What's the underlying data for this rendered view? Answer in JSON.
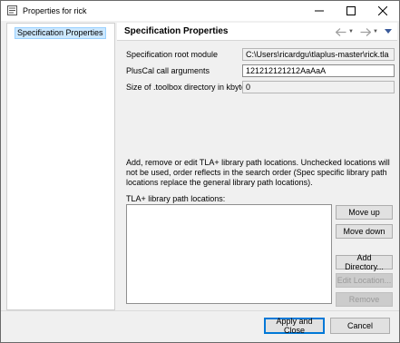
{
  "window": {
    "title": "Properties for rick",
    "controls": {
      "minimize": "minimize",
      "maximize": "maximize",
      "close": "close"
    }
  },
  "tree": {
    "items": [
      {
        "label": "Specification Properties",
        "selected": true
      }
    ]
  },
  "page": {
    "title": "Specification Properties",
    "fields": [
      {
        "label": "Specification root module",
        "value": "C:\\Users\\ricardgu\\tlaplus-master\\rick.tla",
        "editable": false
      },
      {
        "label": "PlusCal call arguments",
        "value": "121212121212AaAaA",
        "editable": true
      },
      {
        "label": "Size of .toolbox directory in kbytes",
        "value": "0",
        "editable": false
      }
    ],
    "description": "Add, remove or edit TLA+ library path locations. Unchecked locations will not be used, order reflects in the search order (Spec specific library path locations replace the general library path locations).",
    "list_label": "TLA+ library path locations:",
    "list_items": [],
    "buttons": {
      "move_up": "Move up",
      "move_down": "Move down",
      "add_directory": "Add Directory...",
      "edit_location": "Edit Location...",
      "remove": "Remove"
    }
  },
  "footer": {
    "apply_close": "Apply and Close",
    "cancel": "Cancel"
  },
  "colors": {
    "selection": "#cce8ff",
    "default_button_border": "#0078d7"
  },
  "icons": [
    "properties-app-icon",
    "back-arrow-icon",
    "forward-arrow-icon",
    "view-menu-icon"
  ]
}
